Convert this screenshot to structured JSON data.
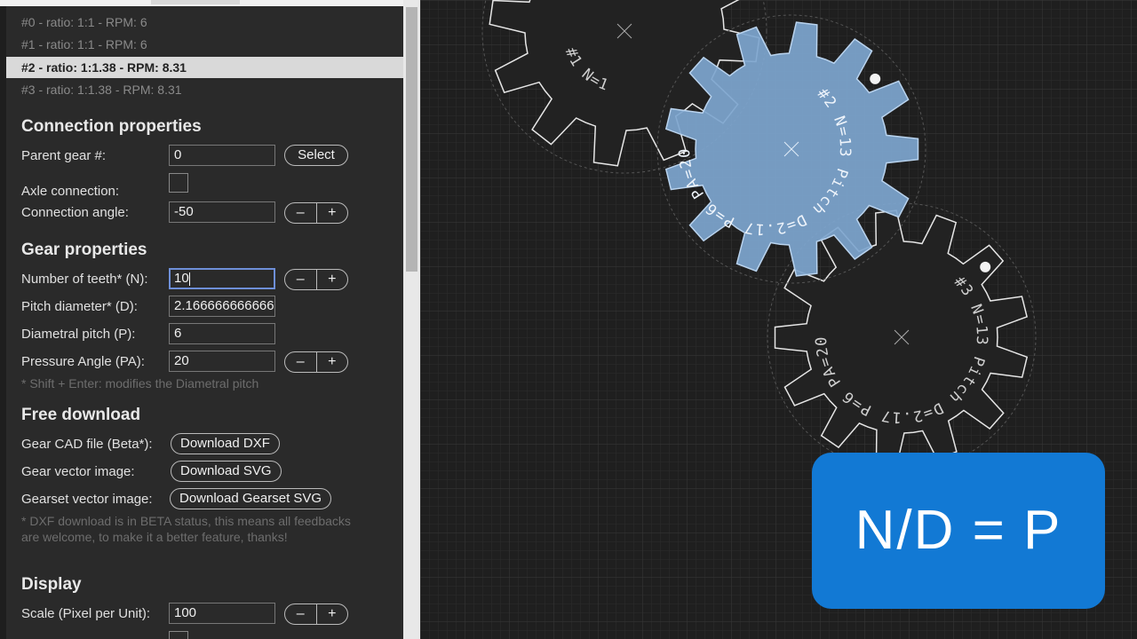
{
  "gear_list": [
    {
      "label": "#0 - ratio: 1:1 - RPM: 6",
      "selected": false
    },
    {
      "label": "#1 - ratio: 1:1 - RPM: 6",
      "selected": false
    },
    {
      "label": "#2 - ratio: 1:1.38 - RPM: 8.31",
      "selected": true
    },
    {
      "label": "#3 - ratio: 1:1.38 - RPM: 8.31",
      "selected": false
    }
  ],
  "connection": {
    "title": "Connection properties",
    "parent_label": "Parent gear #:",
    "parent_value": "0",
    "select_label": "Select",
    "axle_label": "Axle connection:",
    "angle_label": "Connection angle:",
    "angle_value": "-50"
  },
  "gear_props": {
    "title": "Gear properties",
    "teeth_label": "Number of teeth* (N):",
    "teeth_value": "10",
    "pitch_d_label": "Pitch diameter* (D):",
    "pitch_d_value": "2.1666666666666",
    "dp_label": "Diametral pitch (P):",
    "dp_value": "6",
    "pa_label": "Pressure Angle (PA):",
    "pa_value": "20",
    "note": "* Shift + Enter: modifies the Diametral pitch"
  },
  "download": {
    "title": "Free download",
    "cad_label": "Gear CAD file (Beta*):",
    "cad_button": "Download DXF",
    "svg_label": "Gear vector image:",
    "svg_button": "Download SVG",
    "set_label": "Gearset vector image:",
    "set_button": "Download Gearset SVG",
    "note": "* DXF download is in BETA status, this means all feedbacks are welcome, to make it a better feature, thanks!"
  },
  "display": {
    "title": "Display",
    "scale_label": "Scale (Pixel per Unit):",
    "scale_value": "100"
  },
  "stepper": {
    "minus": "–",
    "plus": "+"
  },
  "gears": [
    {
      "id": "gear-0",
      "teeth": 12,
      "selected": false,
      "text": "#1 N=1"
    },
    {
      "id": "gear-2",
      "teeth": 13,
      "selected": true,
      "text": "#2 N=13 Pitch D=2.17 P=6 PA=20"
    },
    {
      "id": "gear-3",
      "teeth": 13,
      "selected": false,
      "text": "#3 N=13 Pitch D=2.17 P=6 PA=20"
    }
  ],
  "formula": "N/D = P",
  "colors": {
    "selected_gear_fill": "#7ea6cf",
    "formula_bg": "#1279d4",
    "panel_bg": "#2a2a2a"
  }
}
